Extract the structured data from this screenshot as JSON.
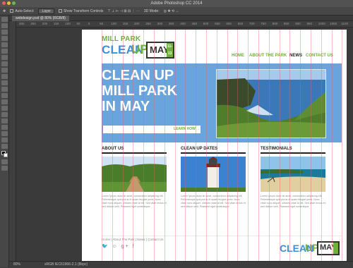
{
  "app": {
    "window_title": "Adobe Photoshop CC 2014",
    "options_bar": {
      "auto_select_label": "Auto-Select:",
      "auto_select_value": "Layer",
      "transform_controls_label": "Show Transform Controls",
      "mode_3d_label": "3D Mode:"
    },
    "document_tab": "webdesign.psd @ 80% (RGB/8)",
    "ruler_ticks": [
      "300",
      "250",
      "200",
      "150",
      "100",
      "50",
      "0",
      "50",
      "100",
      "150",
      "200",
      "250",
      "300",
      "350",
      "400",
      "450",
      "500",
      "550",
      "600",
      "650",
      "700",
      "750",
      "800",
      "850",
      "900",
      "950",
      "1000",
      "1050",
      "1100"
    ],
    "status": {
      "zoom": "80%",
      "info": "sRGB IEC61966-2.1 (8bpc)"
    }
  },
  "site": {
    "logo": {
      "line1": "MILL PARK",
      "clean": "CLEAN",
      "up": "UP",
      "may": "MAY",
      "dates": "11-13"
    },
    "nav": [
      {
        "label": "HOME",
        "active": false
      },
      {
        "label": "ABOUT THE PARK",
        "active": false
      },
      {
        "label": "NEWS",
        "active": true
      },
      {
        "label": "CONTACT US",
        "active": false
      }
    ],
    "hero": {
      "line1": "CLEAN UP",
      "line2": "MILL PARK",
      "line3": "IN MAY",
      "learn_more": "LEARN HOW →"
    },
    "columns": [
      {
        "heading": "ABOUT US",
        "copy": "Lorem ipsum dolor sit amet, consectetur adipiscing elit. Pellentesque quis purus et quam feugiat porta. Nunc vitae nunc aliquet, ultricies vitae at elit. Sed vitae lectus et sed dictum velit. Praesent eget scelerisque."
      },
      {
        "heading": "CLEAN UP DATES",
        "copy": "Lorem ipsum dolor sit amet, consectetur adipiscing elit. Pellentesque quis purus et quam feugiat porta. Nunc vitae nunc aliquet, ultricies vitae at elit. Sed vitae lectus et sed dictum velit. Praesent eget scelerisque."
      },
      {
        "heading": "TESTIMONIALS",
        "copy": "Lorem ipsum dolor sit amet, consectetur adipiscing elit. Pellentesque quis purus et quam feugiat porta. Nunc vitae nunc aliquet, ultricies vitae at elit. Sed vitae lectus et sed dictum velit. Praesent eget scelerisque."
      }
    ],
    "footer": {
      "links": "Home | About The Park | News | Contact Us",
      "social": "🐦 ☺ g+ f"
    }
  },
  "colors": {
    "green": "#6fb13b",
    "blue": "#3d8fd6",
    "hero_blue": "#6aa4dc",
    "guide": "#ec5a6e"
  }
}
